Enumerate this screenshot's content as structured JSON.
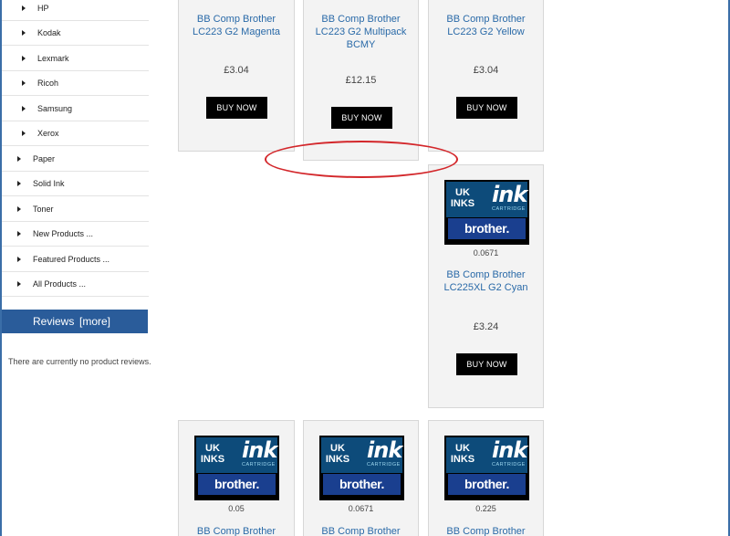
{
  "sidebar": {
    "categories": [
      {
        "label": "HP"
      },
      {
        "label": "Kodak"
      },
      {
        "label": "Lexmark"
      },
      {
        "label": "Ricoh"
      },
      {
        "label": "Samsung"
      },
      {
        "label": "Xerox"
      },
      {
        "label": "Paper"
      },
      {
        "label": "Solid Ink"
      },
      {
        "label": "Toner"
      },
      {
        "label": "New Products ..."
      },
      {
        "label": "Featured Products ..."
      },
      {
        "label": "All Products ..."
      }
    ],
    "reviews": {
      "title": "Reviews",
      "more_label": "[more]",
      "empty_text": "There are currently no product reviews."
    }
  },
  "logo": {
    "uk_line1": "UK",
    "uk_line2": "INKS",
    "ink_word": "ink",
    "cartridge_word": "CARTRIDGE",
    "brand_word": "brother."
  },
  "products": {
    "row1": [
      {
        "name_line1": "BB Comp Brother",
        "name_line2": "LC223 G2 Magenta",
        "name_line3": "",
        "price": "£3.04",
        "buy_label": "BUY NOW"
      },
      {
        "name_line1": "BB Comp Brother",
        "name_line2": "LC223 G2 Multipack",
        "name_line3": "BCMY",
        "price": "£12.15",
        "buy_label": "BUY NOW"
      },
      {
        "name_line1": "BB Comp Brother",
        "name_line2": "LC223 G2 Yellow",
        "name_line3": "",
        "price": "£3.04",
        "buy_label": "BUY NOW"
      }
    ],
    "row2": [
      {
        "stock_value": "0.0671",
        "name_line1": "BB Comp Brother",
        "name_line2": "LC225XL G2 Cyan",
        "price": "£3.24",
        "buy_label": "BUY NOW"
      }
    ],
    "row3": [
      {
        "stock_value": "0.05",
        "name_line1": "BB Comp Brother"
      },
      {
        "stock_value": "0.0671",
        "name_line1": "BB Comp Brother"
      },
      {
        "stock_value": "0.225",
        "name_line1": "BB Comp Brother"
      }
    ]
  },
  "colors": {
    "accent": "#2a5c9a",
    "link": "#2a6aa8",
    "annotation": "#d3272b"
  }
}
